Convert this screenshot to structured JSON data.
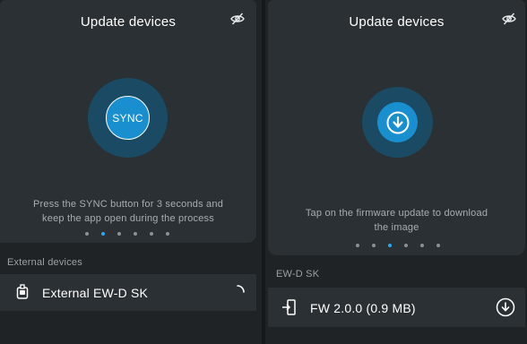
{
  "left_screen": {
    "title": "Update devices",
    "visibility_icon": "eye-off-icon",
    "sync_button_label": "SYNC",
    "instructions": "Press the SYNC button for 3 seconds and keep the app open during the process",
    "pager": {
      "total": 6,
      "active_index": 1
    },
    "section_label": "External devices",
    "device": {
      "name": "External EW-D SK",
      "icon": "device-icon",
      "status_icon": "loading-spinner-icon"
    }
  },
  "right_screen": {
    "title": "Update devices",
    "visibility_icon": "eye-off-icon",
    "center_icon": "download-icon",
    "instructions": "Tap on the firmware update to download the image",
    "pager": {
      "total": 6,
      "active_index": 2
    },
    "section_label": "EW-D SK",
    "firmware": {
      "name": "FW 2.0.0 (0.9 MB)",
      "icon": "device-firmware-icon",
      "action_icon": "download-icon"
    }
  },
  "colors": {
    "background": "#1f2326",
    "card": "#2b3034",
    "accent": "#1a8fd0",
    "accent_dark": "#1a4a64",
    "active_dot": "#2aa8ea",
    "muted_text": "#a7adb1"
  }
}
